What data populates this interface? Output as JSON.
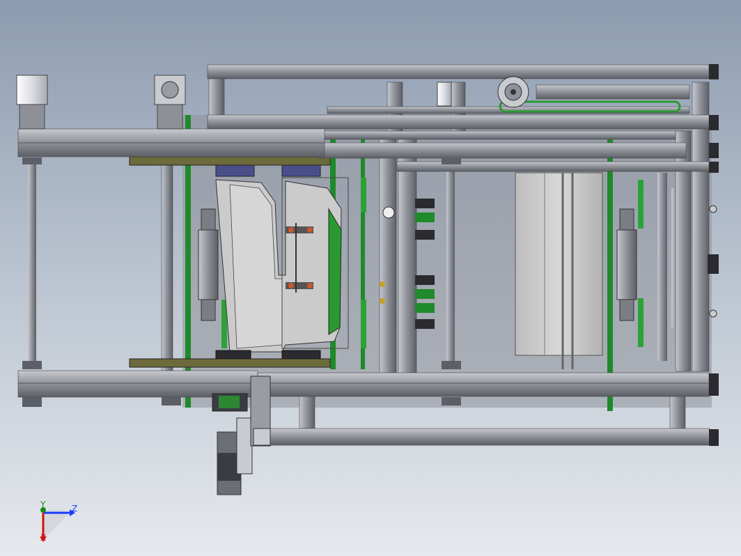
{
  "viewport": {
    "background_top": "#8d9bb0",
    "background_bottom": "#e6e9ed"
  },
  "colors": {
    "frame": "#9a9ca4",
    "frame_dark": "#5c5e66",
    "rail_green": "#1f8a2a",
    "plate_olive": "#6d6a3c",
    "panel_light": "#c9c9c9",
    "clamp_blue": "#4a4f8a",
    "axis_x": "#d01010",
    "axis_y": "#1a8a1a",
    "axis_z": "#1a3cff"
  },
  "triad": {
    "z_label": "Z",
    "y_label": "Y",
    "x_label": "X"
  }
}
